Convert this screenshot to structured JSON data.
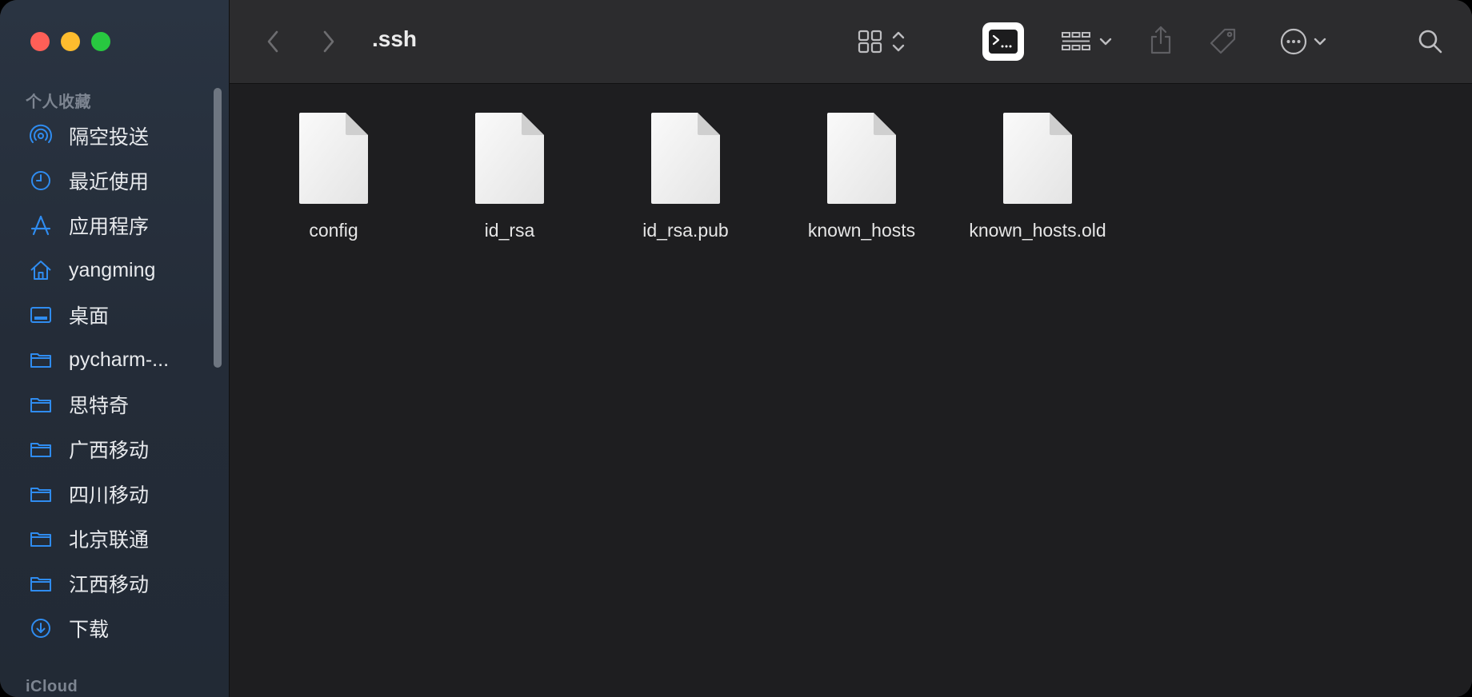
{
  "window": {
    "title": ".ssh"
  },
  "sidebar": {
    "favorites_title": "个人收藏",
    "icloud_title": "iCloud",
    "items": [
      {
        "label": "隔空投送",
        "icon": "airdrop-icon"
      },
      {
        "label": "最近使用",
        "icon": "clock-icon"
      },
      {
        "label": "应用程序",
        "icon": "applications-icon"
      },
      {
        "label": "yangming",
        "icon": "home-icon"
      },
      {
        "label": "桌面",
        "icon": "desktop-icon"
      },
      {
        "label": "pycharm-...",
        "icon": "folder-icon"
      },
      {
        "label": "思特奇",
        "icon": "folder-icon"
      },
      {
        "label": "广西移动",
        "icon": "folder-icon"
      },
      {
        "label": "四川移动",
        "icon": "folder-icon"
      },
      {
        "label": "北京联通",
        "icon": "folder-icon"
      },
      {
        "label": "江西移动",
        "icon": "folder-icon"
      },
      {
        "label": "下载",
        "icon": "download-icon"
      }
    ]
  },
  "toolbar": {
    "back": "chevron-left-icon",
    "forward": "chevron-right-icon",
    "view_mode": "icon-grid-icon",
    "terminal": "terminal-icon",
    "group": "group-icon",
    "share": "share-icon",
    "tag": "tag-icon",
    "more": "ellipsis-circle-icon",
    "search": "search-icon"
  },
  "files": [
    {
      "name": "config"
    },
    {
      "name": "id_rsa"
    },
    {
      "name": "id_rsa.pub"
    },
    {
      "name": "known_hosts"
    },
    {
      "name": "known_hosts.old"
    }
  ],
  "colors": {
    "accent": "#2f8cf0",
    "traffic_red": "#fe5f57",
    "traffic_yellow": "#febc2e",
    "traffic_green": "#28c840"
  }
}
